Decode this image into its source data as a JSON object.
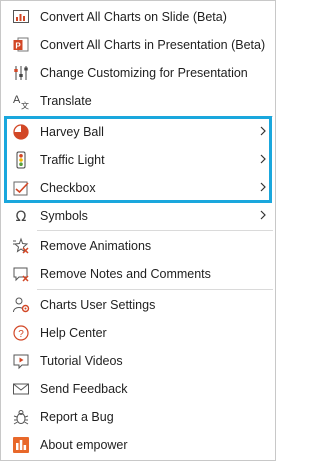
{
  "menu": {
    "items": [
      {
        "label": "Convert All Charts on Slide (Beta)",
        "icon": "chart-convert-slide-icon"
      },
      {
        "label": "Convert All Charts in Presentation (Beta)",
        "icon": "chart-convert-presentation-icon"
      },
      {
        "label": "Change Customizing for Presentation",
        "icon": "sliders-icon"
      },
      {
        "label": "Translate",
        "icon": "translate-icon"
      },
      {
        "label": "Harvey Ball",
        "icon": "harvey-ball-icon",
        "submenu": true
      },
      {
        "label": "Traffic Light",
        "icon": "traffic-light-icon",
        "submenu": true
      },
      {
        "label": "Checkbox",
        "icon": "checkbox-icon",
        "submenu": true
      },
      {
        "label": "Symbols",
        "icon": "omega-icon",
        "submenu": true
      },
      {
        "label": "Remove Animations",
        "icon": "remove-animations-icon"
      },
      {
        "label": "Remove Notes and Comments",
        "icon": "remove-notes-icon"
      },
      {
        "label": "Charts User Settings",
        "icon": "user-settings-icon"
      },
      {
        "label": "Help Center",
        "icon": "help-icon"
      },
      {
        "label": "Tutorial Videos",
        "icon": "video-icon"
      },
      {
        "label": "Send Feedback",
        "icon": "envelope-icon"
      },
      {
        "label": "Report a Bug",
        "icon": "bug-icon"
      },
      {
        "label": "About empower",
        "icon": "empower-logo-icon"
      }
    ]
  },
  "colors": {
    "highlight": "#1aa7dd",
    "accent_red": "#d24726",
    "separator": "#dadada"
  }
}
